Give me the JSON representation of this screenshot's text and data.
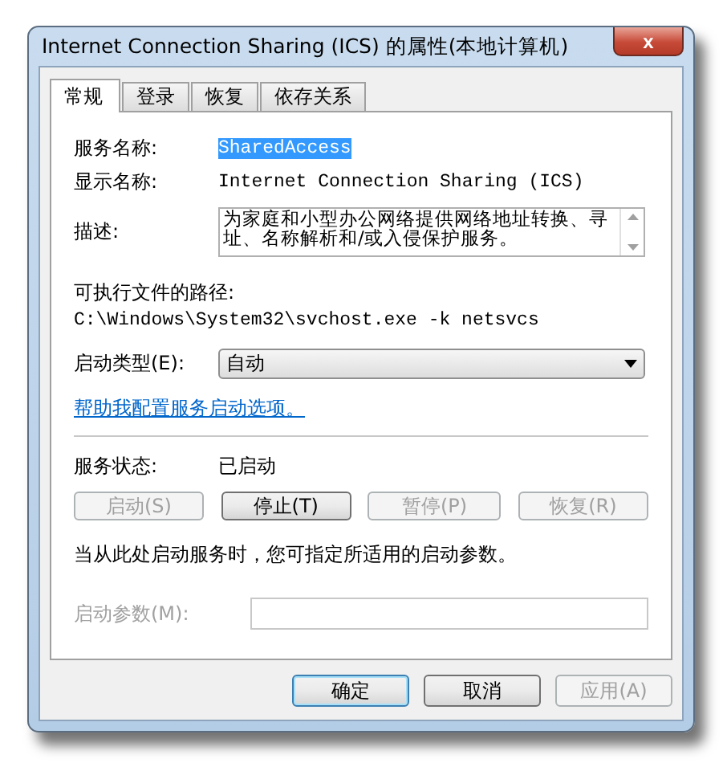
{
  "window": {
    "title": "Internet Connection Sharing (ICS) 的属性(本地计算机)",
    "close": "x"
  },
  "tabs": [
    {
      "label": "常规",
      "selected": true
    },
    {
      "label": "登录",
      "selected": false
    },
    {
      "label": "恢复",
      "selected": false
    },
    {
      "label": "依存关系",
      "selected": false
    }
  ],
  "general": {
    "service_name_label": "服务名称:",
    "service_name": "SharedAccess",
    "service_name_highlighted": true,
    "display_name_label": "显示名称:",
    "display_name": "Internet Connection Sharing (ICS)",
    "description_label": "描述:",
    "description": "为家庭和小型办公网络提供网络地址转换、寻址、名称解析和/或入侵保护服务。",
    "path_label": "可执行文件的路径:",
    "path": "C:\\Windows\\System32\\svchost.exe -k netsvcs",
    "startup_type_label": "启动类型(E):",
    "startup_type": "自动",
    "help_link": "帮助我配置服务启动选项。",
    "status_label": "服务状态:",
    "status": "已启动",
    "service_buttons": [
      {
        "label": "启动(S)",
        "disabled": true
      },
      {
        "label": "停止(T)",
        "disabled": false
      },
      {
        "label": "暂停(P)",
        "disabled": true
      },
      {
        "label": "恢复(R)",
        "disabled": true
      }
    ],
    "hint": "当从此处启动服务时，您可指定所适用的启动参数。",
    "params_label": "启动参数(M):",
    "params_disabled": true
  },
  "buttons": [
    {
      "label": "确定",
      "disabled": false,
      "default": true
    },
    {
      "label": "取消",
      "disabled": false,
      "default": false
    },
    {
      "label": "应用(A)",
      "disabled": true,
      "default": false
    }
  ]
}
